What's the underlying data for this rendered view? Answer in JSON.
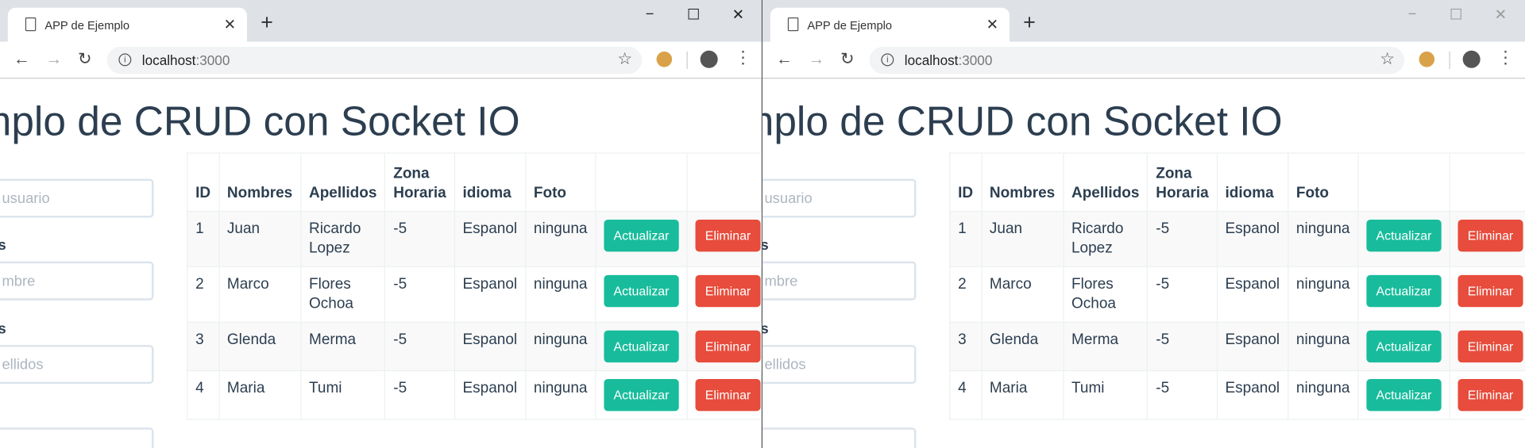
{
  "browser": {
    "tab_title": "APP de Ejemplo",
    "url_host": "localhost",
    "url_port": ":3000"
  },
  "page": {
    "heading": "Ejemplo de CRUD con Socket IO",
    "form": {
      "username_placeholder": "usuario",
      "label_1": "s",
      "name_placeholder": "mbre",
      "label_2": "s",
      "surname_placeholder": "ellidos"
    },
    "table": {
      "headers": [
        "ID",
        "Nombres",
        "Apellidos",
        "Zona Horaria",
        "idioma",
        "Foto"
      ],
      "rows": [
        {
          "id": "1",
          "nombres": "Juan",
          "apellidos": "Ricardo Lopez",
          "zona": "-5",
          "idioma": "Espanol",
          "foto": "ninguna"
        },
        {
          "id": "2",
          "nombres": "Marco",
          "apellidos": "Flores Ochoa",
          "zona": "-5",
          "idioma": "Espanol",
          "foto": "ninguna"
        },
        {
          "id": "3",
          "nombres": "Glenda",
          "apellidos": "Merma",
          "zona": "-5",
          "idioma": "Espanol",
          "foto": "ninguna"
        },
        {
          "id": "4",
          "nombres": "Maria",
          "apellidos": "Tumi",
          "zona": "-5",
          "idioma": "Espanol",
          "foto": "ninguna"
        }
      ],
      "update_label": "Actualizar",
      "delete_label": "Eliminar"
    },
    "colors": {
      "update": "#18bc9c",
      "delete": "#e74c3c",
      "text": "#2c3e50"
    }
  }
}
